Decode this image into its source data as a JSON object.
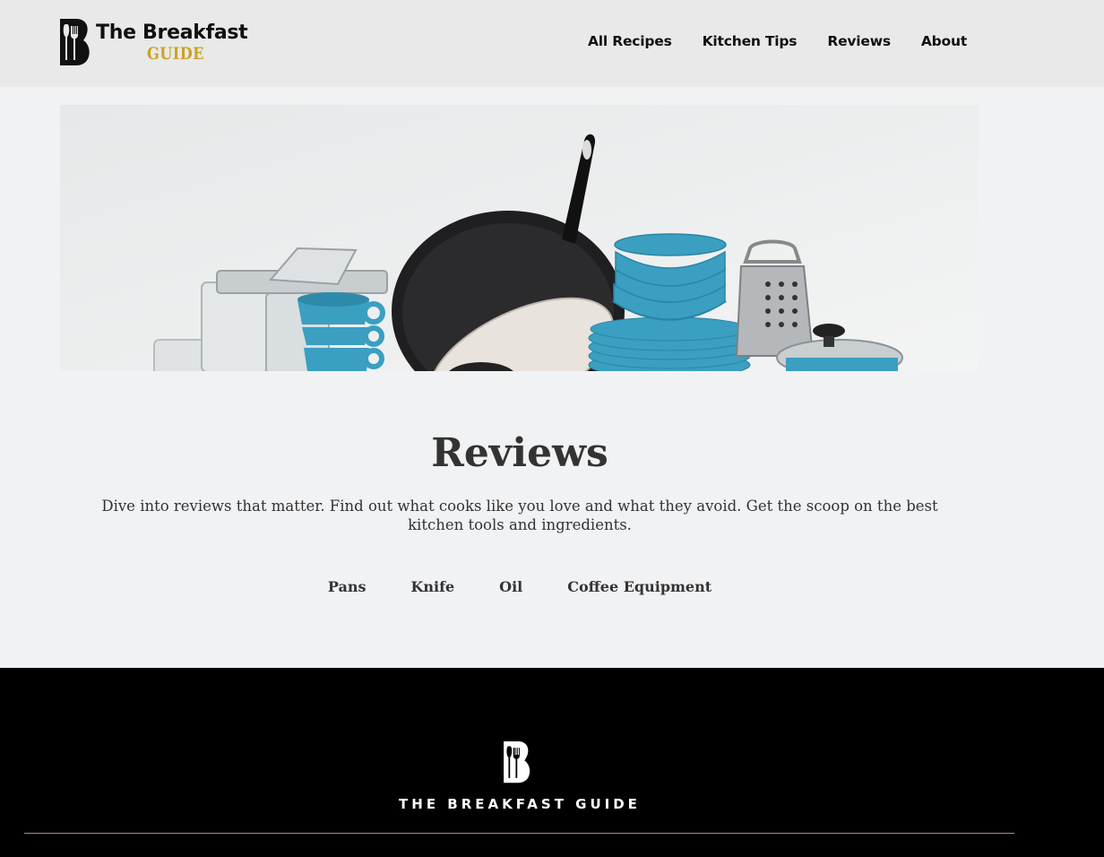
{
  "header": {
    "logo": {
      "line1": "The Breakfast",
      "line2": "GUIDE"
    },
    "nav": [
      {
        "label": "All Recipes"
      },
      {
        "label": "Kitchen Tips"
      },
      {
        "label": "Reviews"
      },
      {
        "label": "About"
      }
    ]
  },
  "hero": {
    "image": "kitchenware-photo"
  },
  "main": {
    "title": "Reviews",
    "description": "Dive into reviews that matter. Find out what cooks like you love and what they avoid. Get the scoop on the best kitchen tools and ingredients.",
    "categories": [
      {
        "label": "Pans"
      },
      {
        "label": "Knife"
      },
      {
        "label": "Oil"
      },
      {
        "label": "Coffee Equipment"
      }
    ]
  },
  "footer": {
    "brand": "THE BREAKFAST GUIDE"
  },
  "colors": {
    "header_bg": "#e9e9e9",
    "page_bg": "#f1f2f4",
    "accent_gold": "#c9a227",
    "footer_bg": "#000000",
    "bowl_blue": "#3a9fc1"
  }
}
